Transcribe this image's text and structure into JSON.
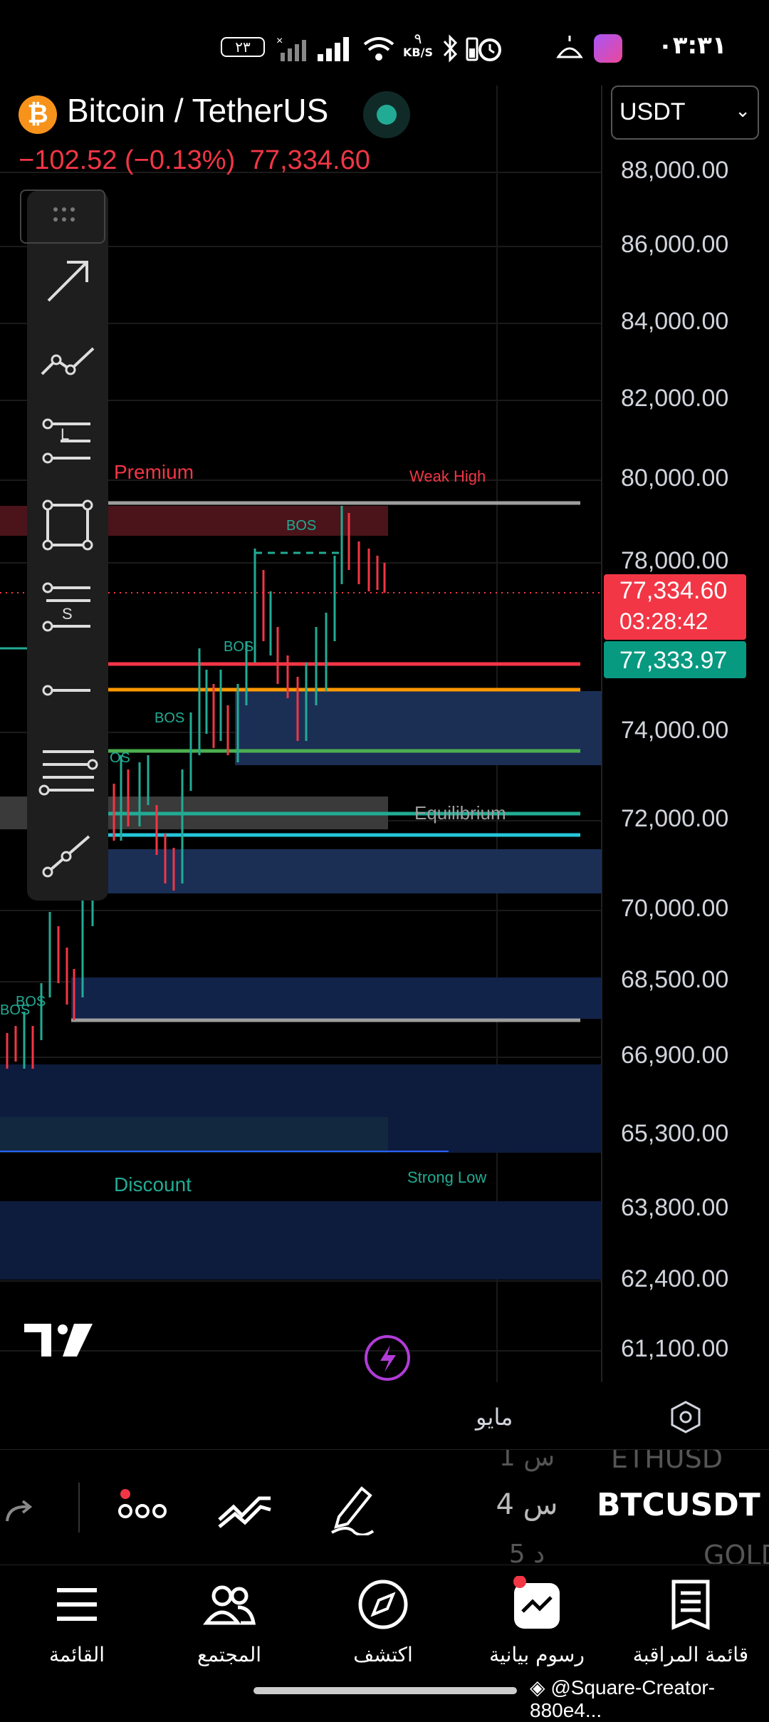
{
  "status_bar": {
    "time": "٠٣:٣١",
    "battery": "٢٣",
    "network_speed_value": "٩",
    "network_speed_unit": "KB/S"
  },
  "header": {
    "pair": "Bitcoin / TetherUS",
    "price_change": "−102.52 (−0.13%)",
    "last_price": "77,334.60",
    "currency": "USDT",
    "colors": {
      "up": "#22ab94",
      "down": "#f23645",
      "coin": "#f7931a"
    }
  },
  "chart_labels": {
    "premium": "Premium",
    "discount": "Discount",
    "weak_high": "Weak High",
    "strong_low": "Strong Low",
    "equilibrium": "Equilibrium",
    "bos": "BOS",
    "bos_partial": "OS"
  },
  "price_axis": {
    "labels": [
      "88,000.00",
      "86,000.00",
      "84,000.00",
      "82,000.00",
      "80,000.00",
      "78,000.00",
      "74,000.00",
      "72,000.00",
      "70,000.00",
      "68,500.00",
      "66,900.00",
      "65,300.00",
      "63,800.00",
      "62,400.00",
      "61,100.00"
    ],
    "current_price": "77,334.60",
    "countdown": "03:28:42",
    "bid_price": "77,333.97"
  },
  "time_axis": {
    "label": "مايو"
  },
  "drawing_tools": [
    "arrow-tool",
    "trend-line-tool",
    "regression-tool",
    "rectangle-tool",
    "fib-tool",
    "horizontal-ray-tool",
    "parallel-channel-tool",
    "path-tool"
  ],
  "symbol_picker": {
    "prev_symbol": "ETHUSD",
    "current_symbol": "BTCUSDT",
    "next_symbol": "GOLD",
    "prev_interval": "1 س",
    "current_interval": "4 س",
    "next_interval": "5 د"
  },
  "bottom_nav": {
    "menu": "القائمة",
    "community": "المجتمع",
    "explore": "اكتشف",
    "charts": "رسوم بيانية",
    "watchlist": "قائمة المراقبة"
  },
  "watermark": "@Square-Creator-880e4..."
}
